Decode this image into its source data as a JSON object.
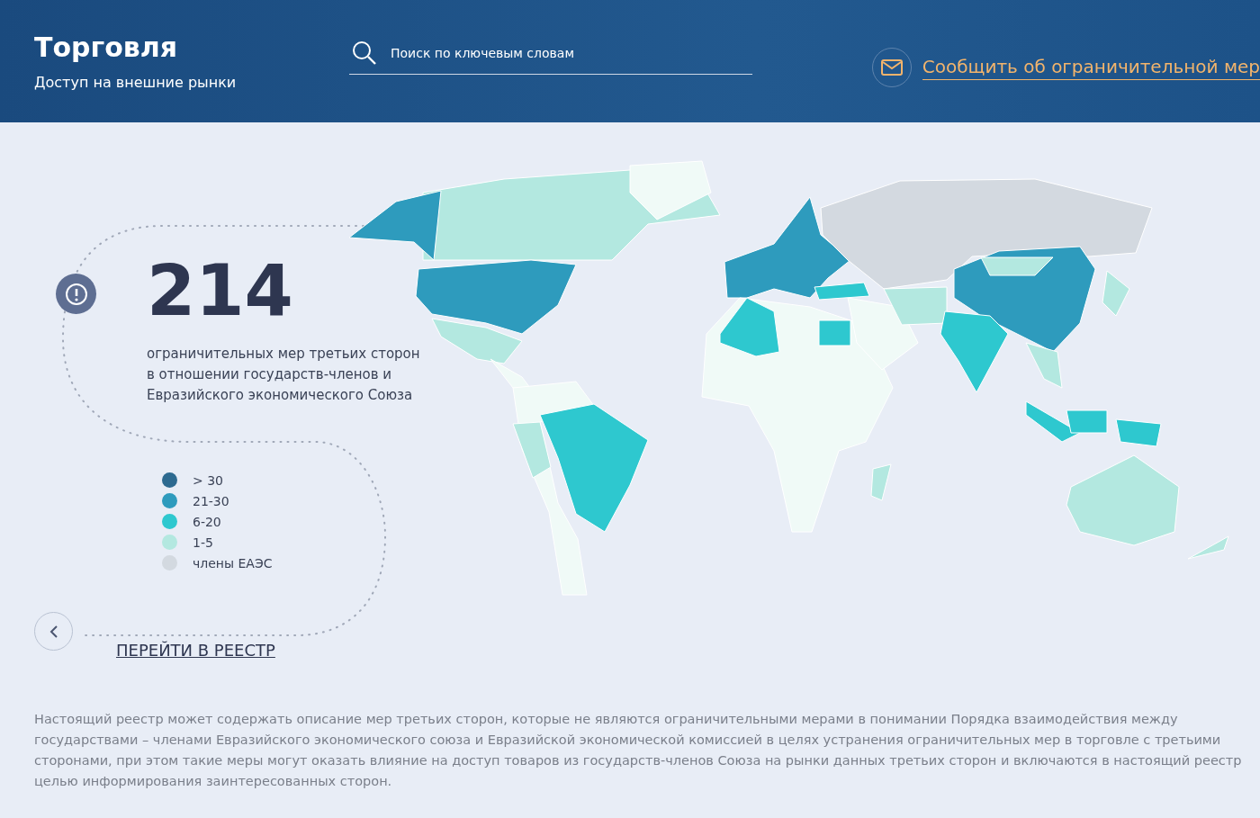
{
  "header": {
    "title": "Торговля",
    "subtitle": "Доступ на внешние рынки",
    "search": {
      "placeholder": "Поиск по ключевым словам"
    },
    "report_link": "Сообщить об ограничительной мер"
  },
  "summary": {
    "count": "214",
    "description": [
      "ограничительных мер третьих сторон",
      "в отношении государств-членов и",
      "Евразийского экономического Союза"
    ]
  },
  "legend": [
    {
      "label": "> 30",
      "color": "#2d6a90"
    },
    {
      "label": "21-30",
      "color": "#2e9bbd"
    },
    {
      "label": "6-20",
      "color": "#2ec8cf"
    },
    {
      "label": "1-5",
      "color": "#b3e8e0"
    },
    {
      "label": "члены ЕАЭС",
      "color": "#d3d9e0"
    }
  ],
  "registry_link": "ПЕРЕЙТИ В РЕЕСТР",
  "disclaimer": [
    "Настоящий реестр может содержать описание мер третьих сторон, которые не являются ограничительными мерами в понимании Порядка взаимодействия между",
    "государствами – членами Евразийского экономического союза и Евразийской экономической комиссией в целях устранения ограничительных мер в торговле с третьими",
    "сторонами, при этом такие меры могут оказать влияние на доступ товаров из государств-членов Союза на рынки данных третьих сторон и включаются в настоящий реестр",
    "целью информирования заинтересованных сторон."
  ]
}
